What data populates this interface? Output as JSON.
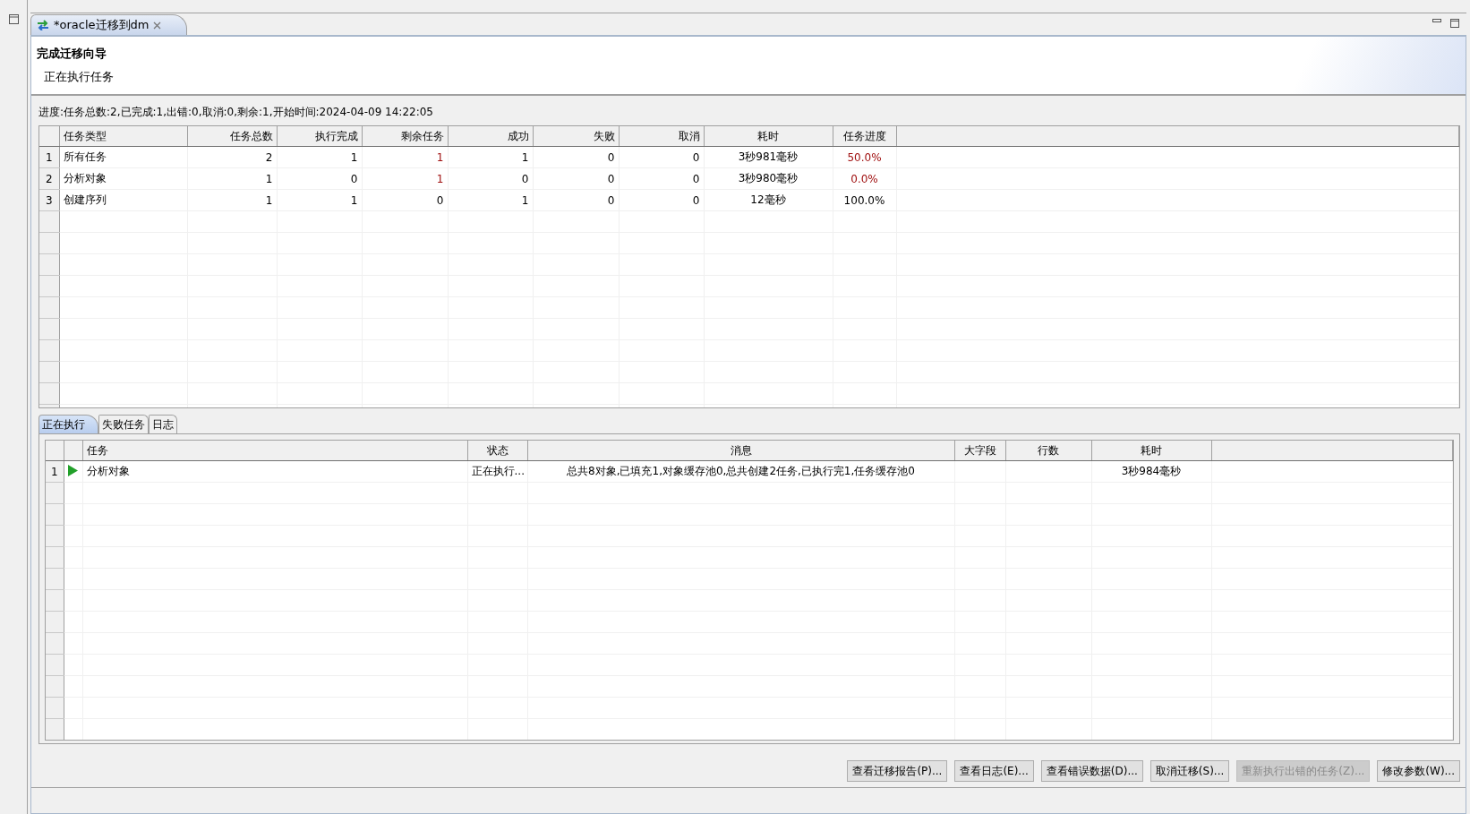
{
  "editor_tab": {
    "title": "*oracle迁移到dm",
    "selected": true
  },
  "header": {
    "title": "完成迁移向导",
    "subtitle": "正在执行任务"
  },
  "progress_text": "进度:任务总数:2,已完成:1,出错:0,取消:0,剩余:1,开始时间:2024-04-09 14:22:05",
  "summary_table": {
    "columns": [
      "任务类型",
      "任务总数",
      "执行完成",
      "剩余任务",
      "成功",
      "失败",
      "取消",
      "耗时",
      "任务进度"
    ],
    "rows": [
      {
        "index": "1",
        "running": true,
        "cells": [
          "所有任务",
          "2",
          "1",
          "1",
          "1",
          "0",
          "0",
          "3秒981毫秒",
          "50.0%"
        ]
      },
      {
        "index": "2",
        "running": true,
        "cells": [
          "分析对象",
          "1",
          "0",
          "1",
          "0",
          "0",
          "0",
          "3秒980毫秒",
          "0.0%"
        ]
      },
      {
        "index": "3",
        "running": false,
        "cells": [
          "创建序列",
          "1",
          "1",
          "0",
          "1",
          "0",
          "0",
          "12毫秒",
          "100.0%"
        ]
      }
    ]
  },
  "tabs": [
    {
      "label": "正在执行",
      "selected": true
    },
    {
      "label": "失败任务",
      "selected": false
    },
    {
      "label": "日志",
      "selected": false
    }
  ],
  "task_table": {
    "columns": [
      "任务",
      "状态",
      "消息",
      "大字段",
      "行数",
      "耗时"
    ],
    "rows": [
      {
        "index": "1",
        "running": true,
        "cells": [
          "分析对象",
          "正在执行...",
          "总共8对象,已填充1,对象缓存池0,总共创建2任务,已执行完1,任务缓存池0",
          "",
          "",
          "3秒984毫秒"
        ]
      }
    ]
  },
  "buttons": [
    {
      "label": "查看迁移报告(P)...",
      "disabled": false
    },
    {
      "label": "查看日志(E)...",
      "disabled": false
    },
    {
      "label": "查看错误数据(D)...",
      "disabled": false
    },
    {
      "label": "取消迁移(S)...",
      "disabled": false
    },
    {
      "label": "重新执行出错的任务(Z)...",
      "disabled": true
    },
    {
      "label": "修改参数(W)...",
      "disabled": false
    }
  ]
}
